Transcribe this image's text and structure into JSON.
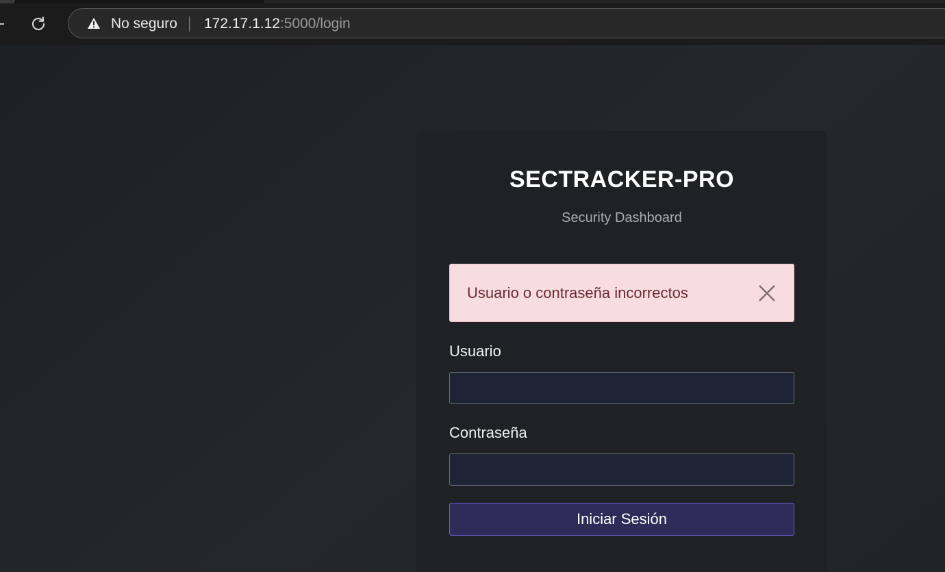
{
  "browser": {
    "back_icon": "back-arrow-icon",
    "reload_icon": "reload-icon",
    "security_icon": "warning-triangle-icon",
    "security_label": "No seguro",
    "url_host": "172.17.1.12",
    "url_rest": ":5000/login"
  },
  "login": {
    "title": "SECTRACKER-PRO",
    "subtitle": "Security Dashboard",
    "alert": {
      "message": "Usuario o contraseña incorrectos",
      "close_icon": "close-icon"
    },
    "username_label": "Usuario",
    "username_value": "",
    "password_label": "Contraseña",
    "password_value": "",
    "submit_label": "Iniciar Sesión"
  },
  "colors": {
    "page_background": "#1f2226",
    "card_background": "#1f2124",
    "alert_background": "#f8dde0",
    "alert_text": "#6b2a31",
    "input_background": "#1e2335",
    "button_background": "#2f2c5a",
    "button_border": "#6a5bd6"
  }
}
